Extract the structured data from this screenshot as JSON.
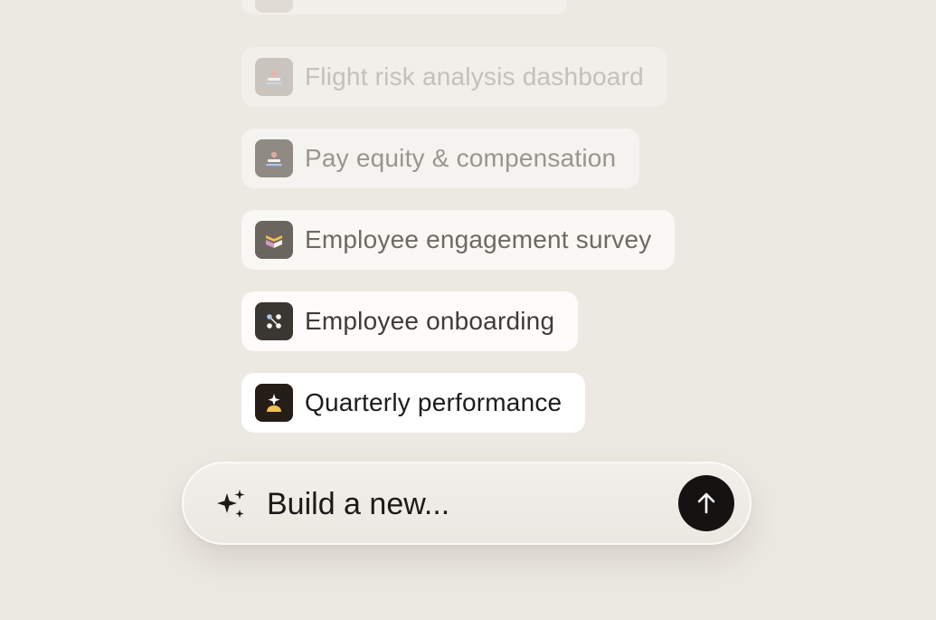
{
  "suggestions": [
    {
      "label": "Flight risk analysis dashboard",
      "icon": "podium-icon"
    },
    {
      "label": "Pay equity & compensation",
      "icon": "podium-icon"
    },
    {
      "label": "Employee engagement survey",
      "icon": "book-chevron-icon"
    },
    {
      "label": "Employee onboarding",
      "icon": "dots-grid-icon"
    },
    {
      "label": "Quarterly performance",
      "icon": "star-person-icon"
    }
  ],
  "composer": {
    "placeholder": "Build a new...",
    "icon": "sparkle-icon",
    "send_icon": "arrow-up-icon"
  },
  "colors": {
    "background": "#ece9e3",
    "send_button": "#141312",
    "accent_yellow": "#f2c14e",
    "accent_pink": "#e2a8a0",
    "accent_blue": "#a9c6e8"
  }
}
